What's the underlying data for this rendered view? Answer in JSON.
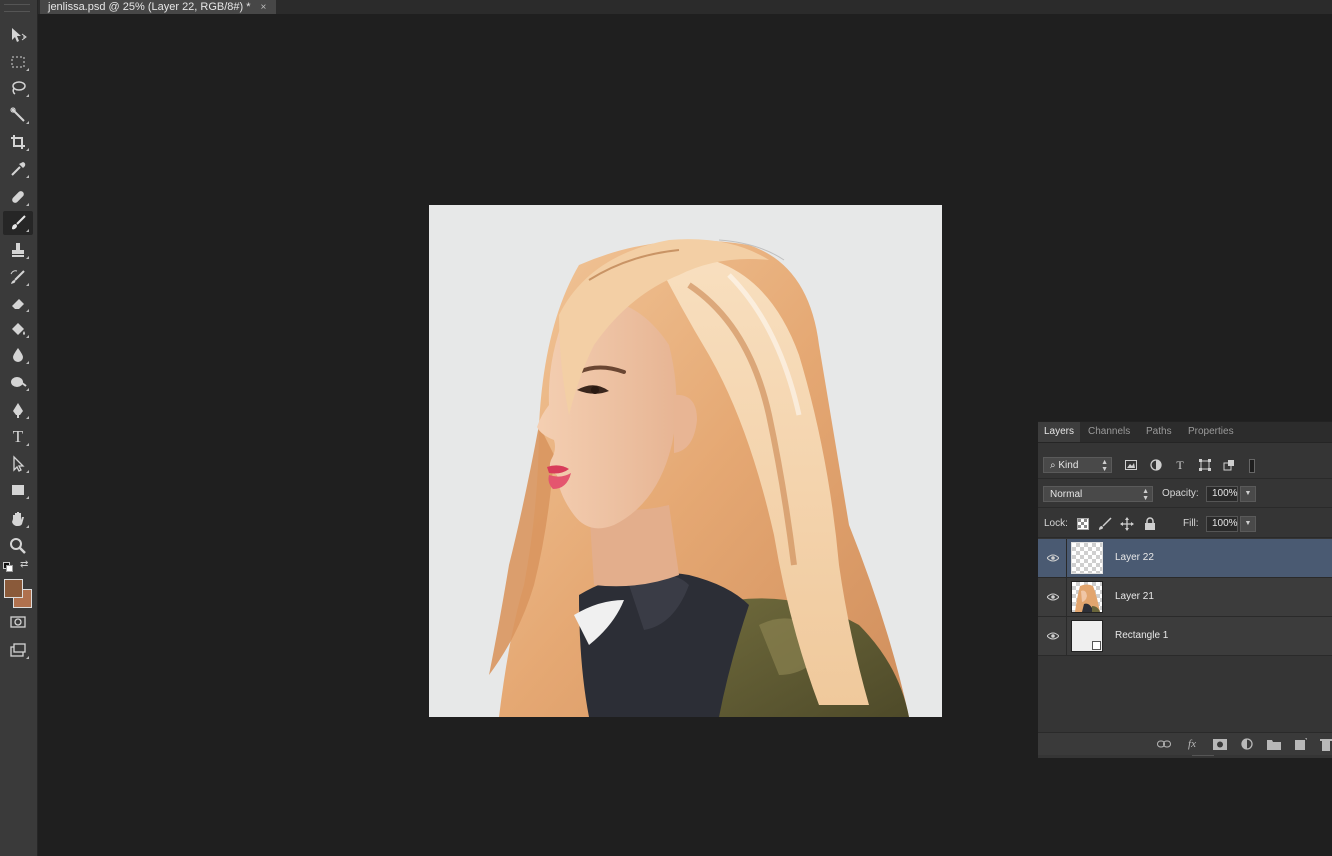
{
  "document_tab": {
    "title": "jenlissa.psd @ 25% (Layer 22, RGB/8#) *",
    "close_glyph": "×"
  },
  "toolbar": {
    "tools": [
      {
        "name": "move-tool",
        "icon": "move-icon"
      },
      {
        "name": "rectangular-marquee-tool",
        "icon": "marquee-icon"
      },
      {
        "name": "lasso-tool",
        "icon": "lasso-icon"
      },
      {
        "name": "magic-wand-tool",
        "icon": "magic-wand-icon"
      },
      {
        "name": "crop-tool",
        "icon": "crop-icon"
      },
      {
        "name": "eyedropper-tool",
        "icon": "eyedropper-icon"
      },
      {
        "name": "spot-healing-tool",
        "icon": "bandage-icon"
      },
      {
        "name": "brush-tool",
        "icon": "brush-icon",
        "active": true
      },
      {
        "name": "clone-stamp-tool",
        "icon": "stamp-icon"
      },
      {
        "name": "history-brush-tool",
        "icon": "history-brush-icon"
      },
      {
        "name": "eraser-tool",
        "icon": "eraser-icon"
      },
      {
        "name": "paint-bucket-tool",
        "icon": "bucket-icon"
      },
      {
        "name": "blur-tool",
        "icon": "drop-icon"
      },
      {
        "name": "dodge-tool",
        "icon": "dodge-icon"
      },
      {
        "name": "pen-tool",
        "icon": "pen-icon"
      },
      {
        "name": "type-tool",
        "icon": "type-icon",
        "glyph": "T"
      },
      {
        "name": "path-selection-tool",
        "icon": "arrow-icon"
      },
      {
        "name": "rectangle-tool",
        "icon": "rectangle-icon"
      },
      {
        "name": "hand-tool",
        "icon": "hand-icon"
      },
      {
        "name": "zoom-tool",
        "icon": "zoom-icon"
      }
    ],
    "foreground_color": "#8a5a3a",
    "background_color": "#b0714e"
  },
  "layers_panel": {
    "tabs": [
      {
        "label": "Layers",
        "active": true
      },
      {
        "label": "Channels"
      },
      {
        "label": "Paths"
      },
      {
        "label": "Properties"
      }
    ],
    "filter": {
      "label": "Kind",
      "search_glyph": "⌕"
    },
    "blend_mode": "Normal",
    "opacity_label": "Opacity:",
    "opacity_value": "100%",
    "lock_label": "Lock:",
    "fill_label": "Fill:",
    "fill_value": "100%",
    "layers": [
      {
        "name": "Layer 22",
        "selected": true,
        "thumb": "transparent"
      },
      {
        "name": "Layer 21",
        "selected": false,
        "thumb": "portrait"
      },
      {
        "name": "Rectangle 1",
        "selected": false,
        "thumb": "shape"
      }
    ],
    "bottom_icons": [
      "link-icon",
      "fx-icon",
      "mask-icon",
      "adjustment-icon",
      "folder-icon",
      "new-layer-icon",
      "trash-icon"
    ],
    "fx_glyph": "fx"
  },
  "colors": {
    "app_bg": "#1f1f1f",
    "selection": "#4a5a72",
    "canvas_bg": "#e7e8e8"
  }
}
